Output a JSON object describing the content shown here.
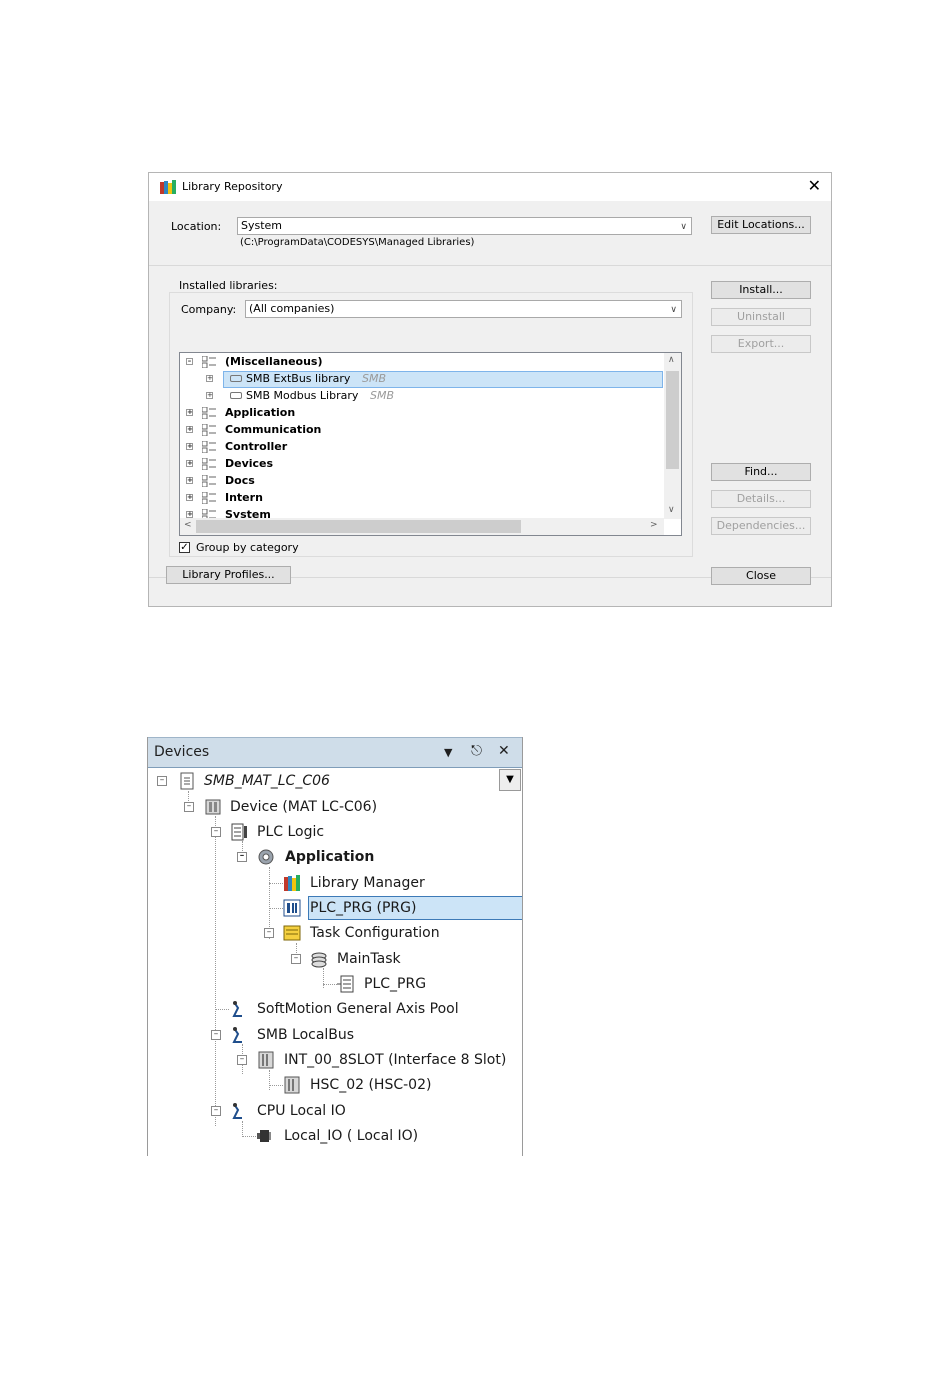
{
  "library_repository": {
    "title": "Library Repository",
    "close_glyph": "✕",
    "location_label": "Location:",
    "location_value": "System",
    "location_path": "(C:\\ProgramData\\CODESYS\\Managed Libraries)",
    "edit_locations_label": "Edit Locations...",
    "installed_libraries_label": "Installed libraries:",
    "company_label": "Company:",
    "company_value": "(All companies)",
    "tree": [
      {
        "label": "(Miscellaneous)",
        "kind": "category",
        "expanded": true
      },
      {
        "label": "SMB ExtBus library",
        "vendor": "SMB",
        "kind": "library",
        "selected": true
      },
      {
        "label": "SMB Modbus Library",
        "vendor": "SMB",
        "kind": "library"
      },
      {
        "label": "Application",
        "kind": "category"
      },
      {
        "label": "Communication",
        "kind": "category"
      },
      {
        "label": "Controller",
        "kind": "category"
      },
      {
        "label": "Devices",
        "kind": "category"
      },
      {
        "label": "Docs",
        "kind": "category"
      },
      {
        "label": "Intern",
        "kind": "category"
      },
      {
        "label": "System",
        "kind": "category"
      }
    ],
    "group_by_category_label": "Group by category",
    "group_by_category_checked": true,
    "buttons": {
      "install": "Install...",
      "uninstall": "Uninstall",
      "export": "Export...",
      "find": "Find...",
      "details": "Details...",
      "dependencies": "Dependencies...",
      "library_profiles": "Library Profiles...",
      "close": "Close"
    }
  },
  "devices_pane": {
    "title": "Devices",
    "header_icons": [
      "dropdown-arrow-icon",
      "pin-icon",
      "close-icon"
    ],
    "tree": [
      {
        "label": "SMB_MAT_LC_C06",
        "icon": "project-icon",
        "italic": true
      },
      {
        "label": "Device (MAT LC-C06)",
        "icon": "device-icon"
      },
      {
        "label": "PLC Logic",
        "icon": "plc-logic-icon"
      },
      {
        "label": "Application",
        "icon": "application-gear-icon",
        "bold": true
      },
      {
        "label": "Library Manager",
        "icon": "library-manager-icon"
      },
      {
        "label": "PLC_PRG (PRG)",
        "icon": "pou-icon",
        "selected": true
      },
      {
        "label": "Task Configuration",
        "icon": "task-configuration-icon"
      },
      {
        "label": "MainTask",
        "icon": "task-icon"
      },
      {
        "label": "PLC_PRG",
        "icon": "program-call-icon"
      },
      {
        "label": "SoftMotion General Axis Pool",
        "icon": "axis-pool-icon"
      },
      {
        "label": "SMB LocalBus",
        "icon": "bus-icon"
      },
      {
        "label": "INT_00_8SLOT (Interface 8 Slot)",
        "icon": "module-icon"
      },
      {
        "label": "HSC_02 (HSC-02)",
        "icon": "module-icon"
      },
      {
        "label": "CPU Local IO",
        "icon": "bus-icon"
      },
      {
        "label": "Local_IO ( Local IO)",
        "icon": "io-icon"
      }
    ]
  },
  "colors": {
    "selection": "#cce4f7",
    "selection_border": "#3d7ab7",
    "pane_header": "#cfdde9",
    "dialog_body": "#f0f0f0"
  }
}
